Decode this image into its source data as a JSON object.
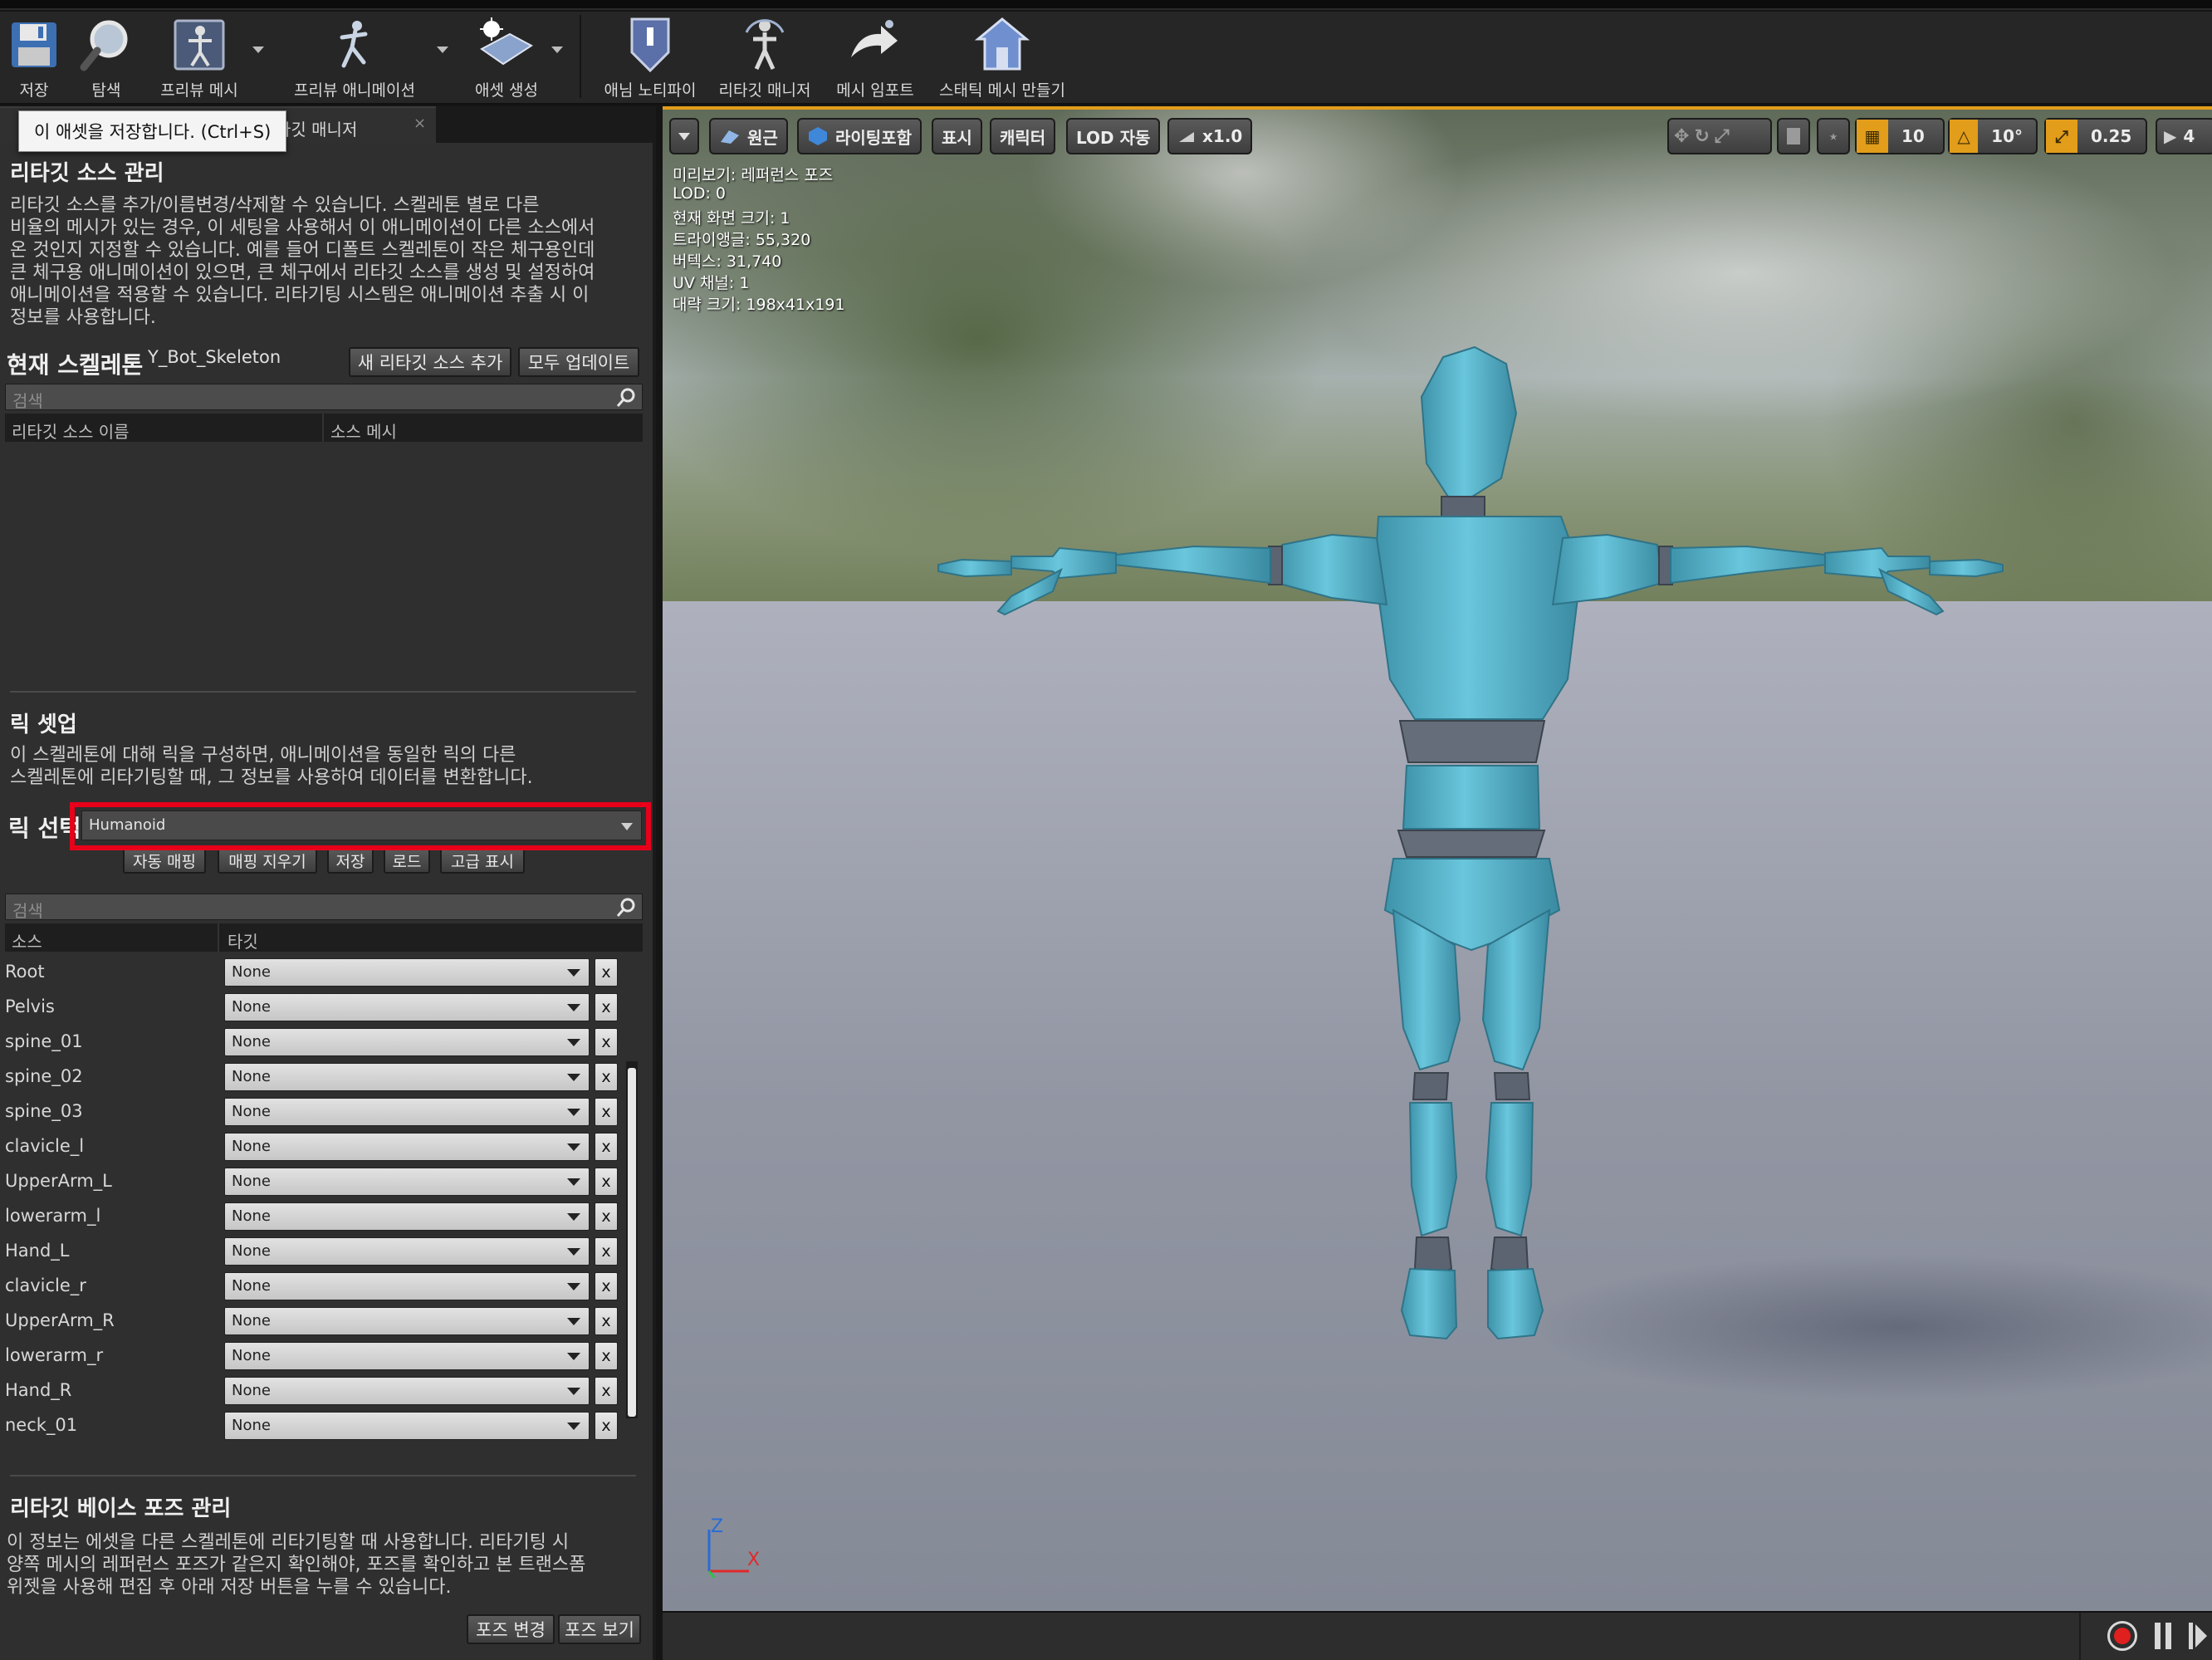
{
  "toolbar": {
    "save": "저장",
    "browse": "탐색",
    "preview_mesh": "프리뷰 메시",
    "preview_animation": "프리뷰 애니메이션",
    "create_asset": "애셋 생성",
    "anim_notify": "애님 노티파이",
    "retarget_manager": "리타깃 매니저",
    "import_mesh": "메시 임포트",
    "make_static_mesh": "스태틱 메시 만들기"
  },
  "tooltip": "이 애셋을 저장합니다. (Ctrl+S)",
  "tab": {
    "label": "타깃 매니저",
    "close": "×"
  },
  "source_section": {
    "title": "리타깃 소스 관리",
    "desc_lines": [
      "리타깃 소스를 추가/이름변경/삭제할 수 있습니다. 스켈레톤 별로 다른",
      "비율의 메시가 있는 경우, 이 세팅을 사용해서 이 애니메이션이 다른 소스에서",
      "온 것인지 지정할 수 있습니다. 예를 들어 디폴트 스켈레톤이 작은 체구용인데",
      "큰 체구용 애니메이션이 있으면, 큰 체구에서 리타깃 소스를 생성 및 설정하여",
      "애니메이션을 적용할 수 있습니다. 리타기팅 시스템은 애니메이션 추출 시 이",
      "정보를 사용합니다."
    ],
    "current_skeleton_label": "현재 스켈레톤",
    "current_skeleton_value": "Y_Bot_Skeleton",
    "add_button": "새 리타깃 소스 추가",
    "update_all_button": "모두 업데이트",
    "search_placeholder": "검색",
    "col_name": "리타깃 소스 이름",
    "col_mesh": "소스 메시"
  },
  "rig_section": {
    "title": "릭 셋업",
    "desc_lines": [
      "이 스켈레톤에 대해 릭을 구성하면, 애니메이션을 동일한 릭의 다른",
      "스켈레톤에 리타기팅할 때, 그 정보를 사용하여 데이터를 변환합니다."
    ],
    "select_label": "릭 선택",
    "selected_rig": "Humanoid",
    "buttons": [
      "자동 매핑",
      "매핑 지우기",
      "저장",
      "로드",
      "고급 표시"
    ],
    "search_placeholder": "검색",
    "col_source": "소스",
    "col_target": "타깃",
    "bones": [
      {
        "name": "Root",
        "target": "None"
      },
      {
        "name": "Pelvis",
        "target": "None"
      },
      {
        "name": "spine_01",
        "target": "None"
      },
      {
        "name": "spine_02",
        "target": "None"
      },
      {
        "name": "spine_03",
        "target": "None"
      },
      {
        "name": "clavicle_l",
        "target": "None"
      },
      {
        "name": "UpperArm_L",
        "target": "None"
      },
      {
        "name": "lowerarm_l",
        "target": "None"
      },
      {
        "name": "Hand_L",
        "target": "None"
      },
      {
        "name": "clavicle_r",
        "target": "None"
      },
      {
        "name": "UpperArm_R",
        "target": "None"
      },
      {
        "name": "lowerarm_r",
        "target": "None"
      },
      {
        "name": "Hand_R",
        "target": "None"
      },
      {
        "name": "neck_01",
        "target": "None"
      }
    ],
    "clear_label": "x"
  },
  "pose_section": {
    "title": "리타깃 베이스 포즈 관리",
    "desc_lines": [
      "이 정보는 에셋을 다른 스켈레톤에 리타기팅할 때 사용합니다. 리타기팅 시",
      "양쪽 메시의 레퍼런스 포즈가 같은지 확인해야, 포즈를 확인하고 본 트랜스폼",
      "위젯을 사용해 편집 후 아래 저장 버튼을 누를 수 있습니다."
    ],
    "modify_pose_button": "포즈 변경",
    "view_pose_button": "포즈 보기"
  },
  "viewport": {
    "perspective": "원근",
    "lighting": "라이팅포함",
    "show": "표시",
    "character": "캐릭터",
    "lod": "LOD 자동",
    "speed": "x1.0",
    "grid_snap": "10",
    "rot_snap": "10°",
    "scale_snap": "0.25",
    "camera_speed": "4",
    "info_lines": [
      "미리보기: 레퍼런스 포즈",
      "LOD: 0",
      "현재 화면 크기: 1",
      "트라이앵글: 55,320",
      "버텍스: 31,740",
      "UV 채널: 1",
      "대략 크기: 198x41x191"
    ],
    "axis_z": "Z",
    "axis_x": "X"
  },
  "colors": {
    "highlight": "#e8001a",
    "accent": "#e29d1a",
    "mannequin": "#5bbcd3"
  }
}
